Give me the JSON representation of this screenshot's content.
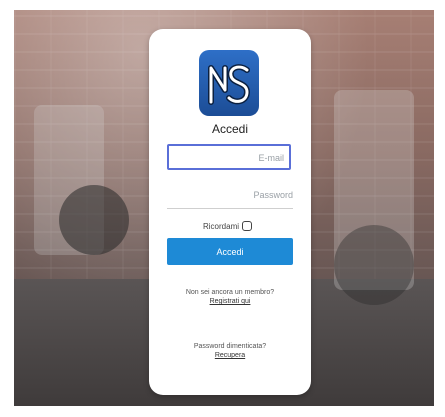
{
  "app": {
    "logo": {
      "icon": "app-logo",
      "colors": [
        "#2e6fc7",
        "#1c4d96"
      ]
    }
  },
  "login": {
    "title": "Accedi",
    "email_placeholder": "E-mail",
    "password_placeholder": "Password",
    "remember_label": "Ricordami",
    "remember_checked": false,
    "submit_label": "Accedi",
    "register_prompt": "Non sei ancora un membro?",
    "register_link": "Registrati qui",
    "forgot_prompt": "Password dimenticata?",
    "forgot_link": "Recupera"
  },
  "colors": {
    "accent": "#1e8ad6",
    "focus_border": "#5a6fd8"
  }
}
